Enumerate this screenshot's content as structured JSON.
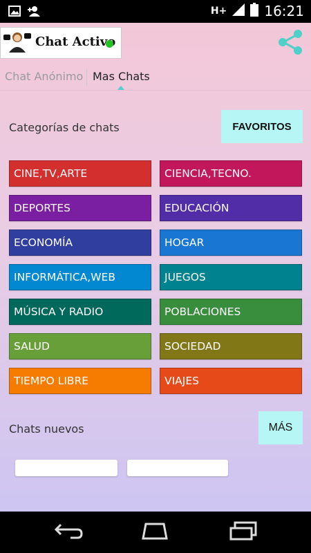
{
  "status_bar": {
    "network": "H+",
    "time": "16:21",
    "left_icons": [
      "image-notification-icon",
      "person-add-notification-icon"
    ],
    "right_icons": [
      "signal-icon",
      "battery-icon"
    ]
  },
  "app_bar": {
    "logo": {
      "title": "Chat  Activo",
      "status_color": "#22c222"
    },
    "share_icon": "share-icon",
    "accent_color": "#4fd0c8"
  },
  "tabs": [
    {
      "label": "Chat Anónimo",
      "active": false
    },
    {
      "label": "Mas Chats",
      "active": true
    }
  ],
  "categories_section": {
    "label": "Categorías de chats",
    "favorites_label": "FAVORITOS"
  },
  "categories": [
    {
      "label": "CINE,TV,ARTE",
      "color": "#d32f2f"
    },
    {
      "label": "CIENCIA,TECNO.",
      "color": "#c2185b"
    },
    {
      "label": "DEPORTES",
      "color": "#7b1fa2"
    },
    {
      "label": "EDUCACIÓN",
      "color": "#512da8"
    },
    {
      "label": "ECONOMÍA",
      "color": "#303f9f"
    },
    {
      "label": "HOGAR",
      "color": "#1976d2"
    },
    {
      "label": "INFORMÁTICA,WEB",
      "color": "#0288d1"
    },
    {
      "label": "JUEGOS",
      "color": "#00838f"
    },
    {
      "label": "MÚSICA Y RADIO",
      "color": "#00695c"
    },
    {
      "label": "POBLACIONES",
      "color": "#388e3c"
    },
    {
      "label": "SALUD",
      "color": "#689f38"
    },
    {
      "label": "SOCIEDAD",
      "color": "#827717"
    },
    {
      "label": "TIEMPO LIBRE",
      "color": "#f57c00"
    },
    {
      "label": "VIAJES",
      "color": "#e64a19"
    }
  ],
  "new_chats_section": {
    "label": "Chats nuevos",
    "more_label": "MÁS"
  },
  "nav_bar": {
    "buttons": [
      "back-icon",
      "home-icon",
      "recent-apps-icon"
    ]
  }
}
